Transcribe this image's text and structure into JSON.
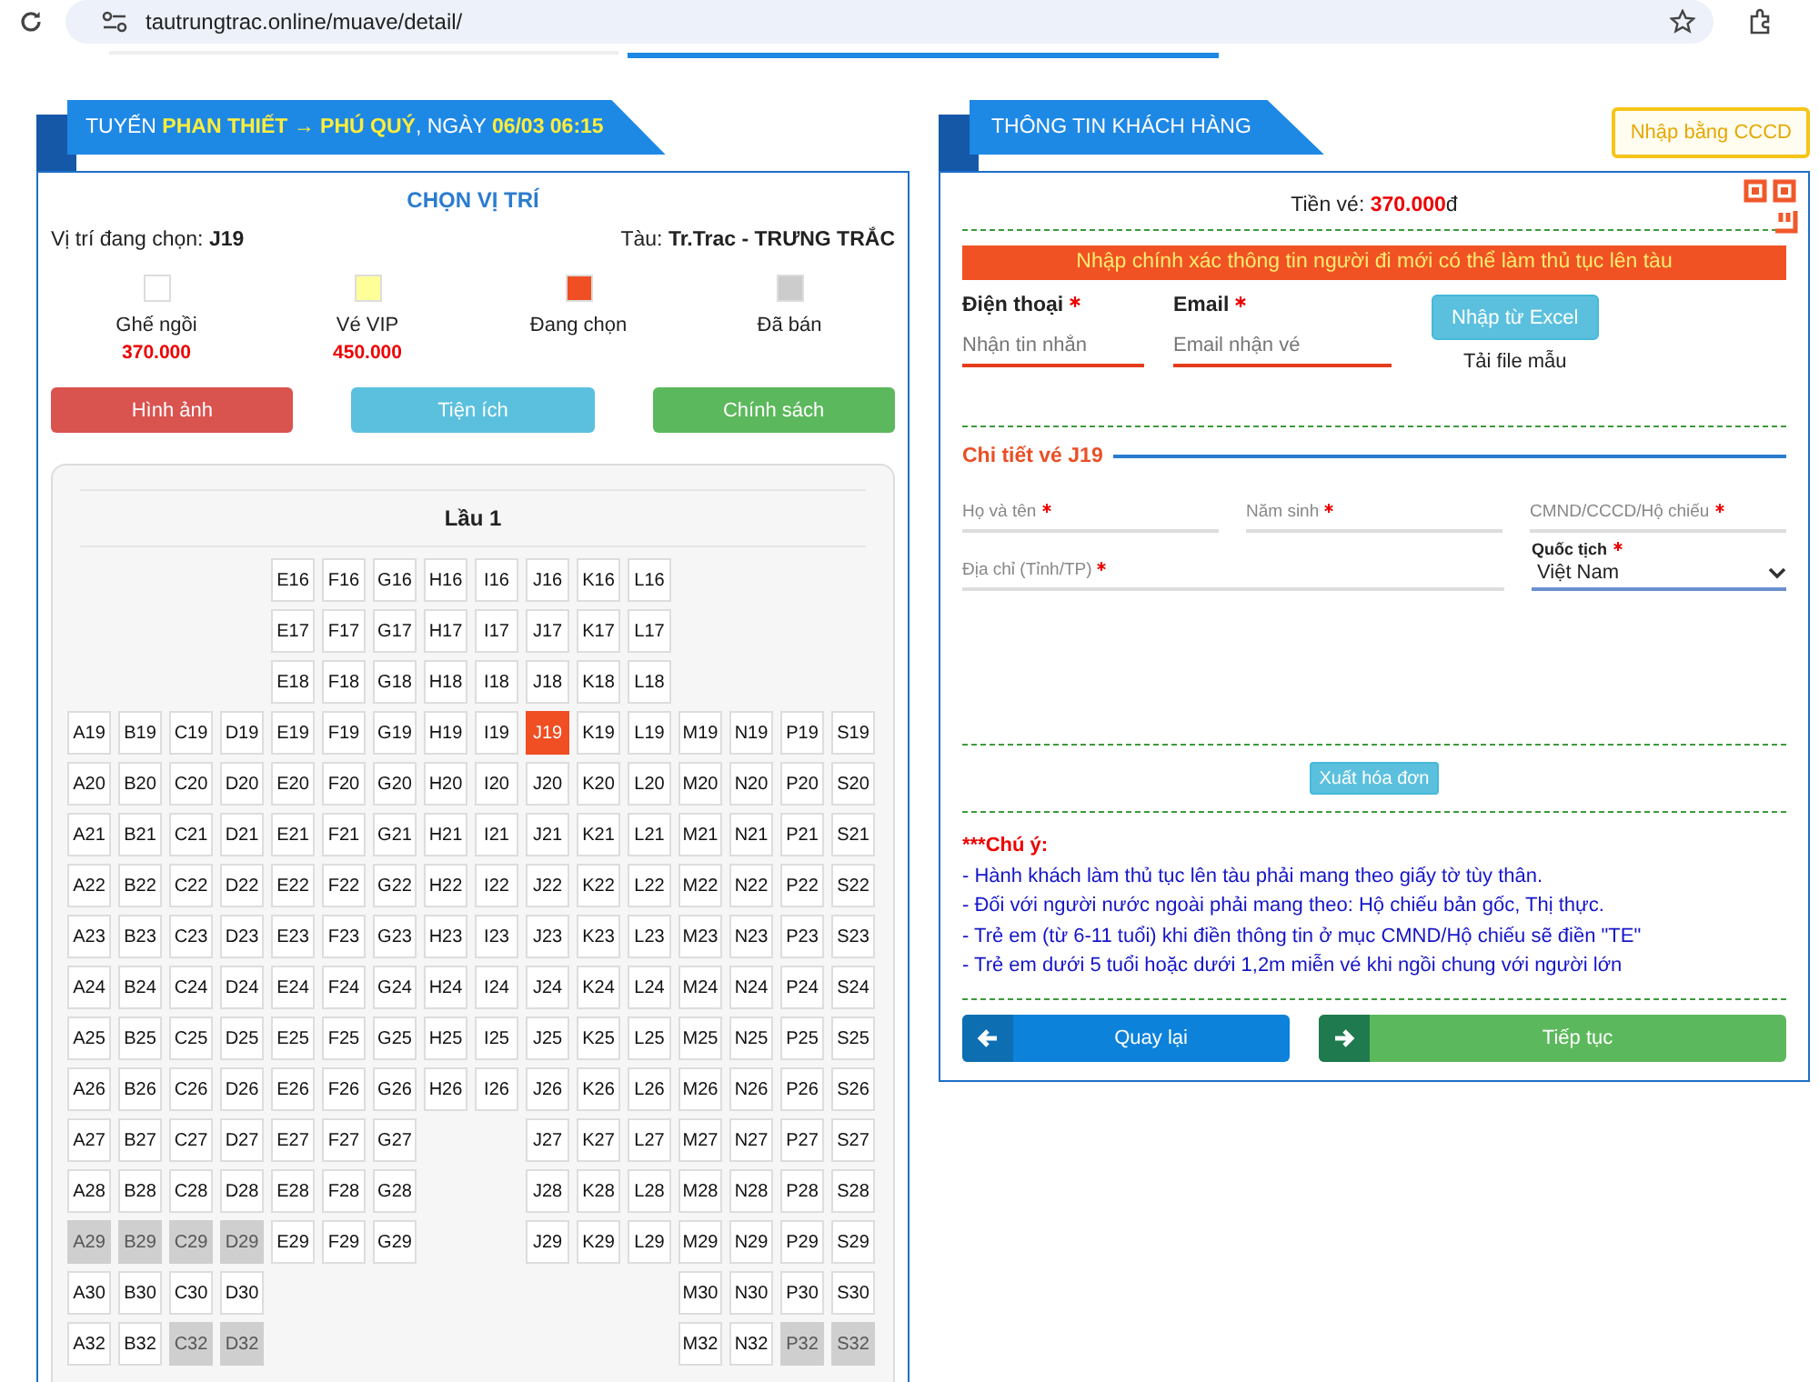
{
  "browser": {
    "url": "tautrungtrac.online/muave/detail/"
  },
  "trip": {
    "title": "TUYẾN **PHAN THIẾT → PHÚ QUÝ**, NGÀY **06/03 06:15**",
    "heading": "CHỌN VỊ TRÍ",
    "current_label": "Vị trí đang chọn:",
    "current_seat": "J19",
    "ship_label": "Tàu:",
    "ship_name": "Tr.Trac - TRƯNG TRẮC",
    "legend": [
      {
        "color": "#ffffff",
        "label": "Ghế ngồi",
        "price": "370.000"
      },
      {
        "color": "#ffff99",
        "label": "Vé VIP",
        "price": "450.000"
      },
      {
        "color": "#f04e23",
        "label": "Đang chọn"
      },
      {
        "color": "#cccccc",
        "label": "Đã bán"
      }
    ],
    "buttons": [
      {
        "label": "Hình ảnh",
        "color": "#d9534f"
      },
      {
        "label": "Tiện ích",
        "color": "#5bc0de"
      },
      {
        "label": "Chính sách",
        "color": "#5cb85c"
      }
    ],
    "deck": "Lầu 1",
    "rows": [
      {
        "seats": [
          {
            "kind": "gap"
          },
          {
            "kind": "gap"
          },
          {
            "kind": "gap"
          },
          {
            "kind": "gap"
          },
          {
            "kind": "seat",
            "label": "E16",
            "selected": false,
            "sold": false
          },
          {
            "kind": "seat",
            "label": "F16",
            "selected": false,
            "sold": false
          },
          {
            "kind": "seat",
            "label": "G16",
            "selected": false,
            "sold": false
          },
          {
            "kind": "seat",
            "label": "H16",
            "selected": false,
            "sold": false
          },
          {
            "kind": "seat",
            "label": "I16",
            "selected": false,
            "sold": false
          },
          {
            "kind": "seat",
            "label": "J16",
            "selected": false,
            "sold": false
          },
          {
            "kind": "seat",
            "label": "K16",
            "selected": false,
            "sold": false
          },
          {
            "kind": "seat",
            "label": "L16",
            "selected": false,
            "sold": false
          }
        ]
      },
      {
        "seats": [
          {
            "kind": "gap"
          },
          {
            "kind": "gap"
          },
          {
            "kind": "gap"
          },
          {
            "kind": "gap"
          },
          {
            "kind": "seat",
            "label": "E17",
            "selected": false,
            "sold": false
          },
          {
            "kind": "seat",
            "label": "F17",
            "selected": false,
            "sold": false
          },
          {
            "kind": "seat",
            "label": "G17",
            "selected": false,
            "sold": false
          },
          {
            "kind": "seat",
            "label": "H17",
            "selected": false,
            "sold": false
          },
          {
            "kind": "seat",
            "label": "I17",
            "selected": false,
            "sold": false
          },
          {
            "kind": "seat",
            "label": "J17",
            "selected": false,
            "sold": false
          },
          {
            "kind": "seat",
            "label": "K17",
            "selected": false,
            "sold": false
          },
          {
            "kind": "seat",
            "label": "L17",
            "selected": false,
            "sold": false
          }
        ]
      },
      {
        "seats": [
          {
            "kind": "gap"
          },
          {
            "kind": "gap"
          },
          {
            "kind": "gap"
          },
          {
            "kind": "gap"
          },
          {
            "kind": "seat",
            "label": "E18",
            "selected": false,
            "sold": false
          },
          {
            "kind": "seat",
            "label": "F18",
            "selected": false,
            "sold": false
          },
          {
            "kind": "seat",
            "label": "G18",
            "selected": false,
            "sold": false
          },
          {
            "kind": "seat",
            "label": "H18",
            "selected": false,
            "sold": false
          },
          {
            "kind": "seat",
            "label": "I18",
            "selected": false,
            "sold": false
          },
          {
            "kind": "seat",
            "label": "J18",
            "selected": false,
            "sold": false
          },
          {
            "kind": "seat",
            "label": "K18",
            "selected": false,
            "sold": false
          },
          {
            "kind": "seat",
            "label": "L18",
            "selected": false,
            "sold": false
          }
        ]
      },
      {
        "seats": [
          {
            "kind": "seat",
            "label": "A19",
            "selected": false,
            "sold": false
          },
          {
            "kind": "seat",
            "label": "B19",
            "selected": false,
            "sold": false
          },
          {
            "kind": "seat",
            "label": "C19",
            "selected": false,
            "sold": false
          },
          {
            "kind": "seat",
            "label": "D19",
            "selected": false,
            "sold": false
          },
          {
            "kind": "seat",
            "label": "E19",
            "selected": false,
            "sold": false
          },
          {
            "kind": "seat",
            "label": "F19",
            "selected": false,
            "sold": false
          },
          {
            "kind": "seat",
            "label": "G19",
            "selected": false,
            "sold": false
          },
          {
            "kind": "seat",
            "label": "H19",
            "selected": false,
            "sold": false
          },
          {
            "kind": "seat",
            "label": "I19",
            "selected": false,
            "sold": false
          },
          {
            "kind": "seat",
            "label": "J19",
            "selected": true,
            "sold": false
          },
          {
            "kind": "seat",
            "label": "K19",
            "selected": false,
            "sold": false
          },
          {
            "kind": "seat",
            "label": "L19",
            "selected": false,
            "sold": false
          },
          {
            "kind": "seat",
            "label": "M19",
            "selected": false,
            "sold": false
          },
          {
            "kind": "seat",
            "label": "N19",
            "selected": false,
            "sold": false
          },
          {
            "kind": "seat",
            "label": "P19",
            "selected": false,
            "sold": false
          },
          {
            "kind": "seat",
            "label": "S19",
            "selected": false,
            "sold": false
          }
        ]
      },
      {
        "seats": [
          {
            "kind": "seat",
            "label": "A20",
            "selected": false,
            "sold": false
          },
          {
            "kind": "seat",
            "label": "B20",
            "selected": false,
            "sold": false
          },
          {
            "kind": "seat",
            "label": "C20",
            "selected": false,
            "sold": false
          },
          {
            "kind": "seat",
            "label": "D20",
            "selected": false,
            "sold": false
          },
          {
            "kind": "seat",
            "label": "E20",
            "selected": false,
            "sold": false
          },
          {
            "kind": "seat",
            "label": "F20",
            "selected": false,
            "sold": false
          },
          {
            "kind": "seat",
            "label": "G20",
            "selected": false,
            "sold": false
          },
          {
            "kind": "seat",
            "label": "H20",
            "selected": false,
            "sold": false
          },
          {
            "kind": "seat",
            "label": "I20",
            "selected": false,
            "sold": false
          },
          {
            "kind": "seat",
            "label": "J20",
            "selected": false,
            "sold": false
          },
          {
            "kind": "seat",
            "label": "K20",
            "selected": false,
            "sold": false
          },
          {
            "kind": "seat",
            "label": "L20",
            "selected": false,
            "sold": false
          },
          {
            "kind": "seat",
            "label": "M20",
            "selected": false,
            "sold": false
          },
          {
            "kind": "seat",
            "label": "N20",
            "selected": false,
            "sold": false
          },
          {
            "kind": "seat",
            "label": "P20",
            "selected": false,
            "sold": false
          },
          {
            "kind": "seat",
            "label": "S20",
            "selected": false,
            "sold": false
          }
        ]
      },
      {
        "seats": [
          {
            "kind": "seat",
            "label": "A21",
            "selected": false,
            "sold": false
          },
          {
            "kind": "seat",
            "label": "B21",
            "selected": false,
            "sold": false
          },
          {
            "kind": "seat",
            "label": "C21",
            "selected": false,
            "sold": false
          },
          {
            "kind": "seat",
            "label": "D21",
            "selected": false,
            "sold": false
          },
          {
            "kind": "seat",
            "label": "E21",
            "selected": false,
            "sold": false
          },
          {
            "kind": "seat",
            "label": "F21",
            "selected": false,
            "sold": false
          },
          {
            "kind": "seat",
            "label": "G21",
            "selected": false,
            "sold": false
          },
          {
            "kind": "seat",
            "label": "H21",
            "selected": false,
            "sold": false
          },
          {
            "kind": "seat",
            "label": "I21",
            "selected": false,
            "sold": false
          },
          {
            "kind": "seat",
            "label": "J21",
            "selected": false,
            "sold": false
          },
          {
            "kind": "seat",
            "label": "K21",
            "selected": false,
            "sold": false
          },
          {
            "kind": "seat",
            "label": "L21",
            "selected": false,
            "sold": false
          },
          {
            "kind": "seat",
            "label": "M21",
            "selected": false,
            "sold": false
          },
          {
            "kind": "seat",
            "label": "N21",
            "selected": false,
            "sold": false
          },
          {
            "kind": "seat",
            "label": "P21",
            "selected": false,
            "sold": false
          },
          {
            "kind": "seat",
            "label": "S21",
            "selected": false,
            "sold": false
          }
        ]
      },
      {
        "seats": [
          {
            "kind": "seat",
            "label": "A22",
            "selected": false,
            "sold": false
          },
          {
            "kind": "seat",
            "label": "B22",
            "selected": false,
            "sold": false
          },
          {
            "kind": "seat",
            "label": "C22",
            "selected": false,
            "sold": false
          },
          {
            "kind": "seat",
            "label": "D22",
            "selected": false,
            "sold": false
          },
          {
            "kind": "seat",
            "label": "E22",
            "selected": false,
            "sold": false
          },
          {
            "kind": "seat",
            "label": "F22",
            "selected": false,
            "sold": false
          },
          {
            "kind": "seat",
            "label": "G22",
            "selected": false,
            "sold": false
          },
          {
            "kind": "seat",
            "label": "H22",
            "selected": false,
            "sold": false
          },
          {
            "kind": "seat",
            "label": "I22",
            "selected": false,
            "sold": false
          },
          {
            "kind": "seat",
            "label": "J22",
            "selected": false,
            "sold": false
          },
          {
            "kind": "seat",
            "label": "K22",
            "selected": false,
            "sold": false
          },
          {
            "kind": "seat",
            "label": "L22",
            "selected": false,
            "sold": false
          },
          {
            "kind": "seat",
            "label": "M22",
            "selected": false,
            "sold": false
          },
          {
            "kind": "seat",
            "label": "N22",
            "selected": false,
            "sold": false
          },
          {
            "kind": "seat",
            "label": "P22",
            "selected": false,
            "sold": false
          },
          {
            "kind": "seat",
            "label": "S22",
            "selected": false,
            "sold": false
          }
        ]
      },
      {
        "seats": [
          {
            "kind": "seat",
            "label": "A23",
            "selected": false,
            "sold": false
          },
          {
            "kind": "seat",
            "label": "B23",
            "selected": false,
            "sold": false
          },
          {
            "kind": "seat",
            "label": "C23",
            "selected": false,
            "sold": false
          },
          {
            "kind": "seat",
            "label": "D23",
            "selected": false,
            "sold": false
          },
          {
            "kind": "seat",
            "label": "E23",
            "selected": false,
            "sold": false
          },
          {
            "kind": "seat",
            "label": "F23",
            "selected": false,
            "sold": false
          },
          {
            "kind": "seat",
            "label": "G23",
            "selected": false,
            "sold": false
          },
          {
            "kind": "seat",
            "label": "H23",
            "selected": false,
            "sold": false
          },
          {
            "kind": "seat",
            "label": "I23",
            "selected": false,
            "sold": false
          },
          {
            "kind": "seat",
            "label": "J23",
            "selected": false,
            "sold": false
          },
          {
            "kind": "seat",
            "label": "K23",
            "selected": false,
            "sold": false
          },
          {
            "kind": "seat",
            "label": "L23",
            "selected": false,
            "sold": false
          },
          {
            "kind": "seat",
            "label": "M23",
            "selected": false,
            "sold": false
          },
          {
            "kind": "seat",
            "label": "N23",
            "selected": false,
            "sold": false
          },
          {
            "kind": "seat",
            "label": "P23",
            "selected": false,
            "sold": false
          },
          {
            "kind": "seat",
            "label": "S23",
            "selected": false,
            "sold": false
          }
        ]
      },
      {
        "seats": [
          {
            "kind": "seat",
            "label": "A24",
            "selected": false,
            "sold": false
          },
          {
            "kind": "seat",
            "label": "B24",
            "selected": false,
            "sold": false
          },
          {
            "kind": "seat",
            "label": "C24",
            "selected": false,
            "sold": false
          },
          {
            "kind": "seat",
            "label": "D24",
            "selected": false,
            "sold": false
          },
          {
            "kind": "seat",
            "label": "E24",
            "selected": false,
            "sold": false
          },
          {
            "kind": "seat",
            "label": "F24",
            "selected": false,
            "sold": false
          },
          {
            "kind": "seat",
            "label": "G24",
            "selected": false,
            "sold": false
          },
          {
            "kind": "seat",
            "label": "H24",
            "selected": false,
            "sold": false
          },
          {
            "kind": "seat",
            "label": "I24",
            "selected": false,
            "sold": false
          },
          {
            "kind": "seat",
            "label": "J24",
            "selected": false,
            "sold": false
          },
          {
            "kind": "seat",
            "label": "K24",
            "selected": false,
            "sold": false
          },
          {
            "kind": "seat",
            "label": "L24",
            "selected": false,
            "sold": false
          },
          {
            "kind": "seat",
            "label": "M24",
            "selected": false,
            "sold": false
          },
          {
            "kind": "seat",
            "label": "N24",
            "selected": false,
            "sold": false
          },
          {
            "kind": "seat",
            "label": "P24",
            "selected": false,
            "sold": false
          },
          {
            "kind": "seat",
            "label": "S24",
            "selected": false,
            "sold": false
          }
        ]
      },
      {
        "seats": [
          {
            "kind": "seat",
            "label": "A25",
            "selected": false,
            "sold": false
          },
          {
            "kind": "seat",
            "label": "B25",
            "selected": false,
            "sold": false
          },
          {
            "kind": "seat",
            "label": "C25",
            "selected": false,
            "sold": false
          },
          {
            "kind": "seat",
            "label": "D25",
            "selected": false,
            "sold": false
          },
          {
            "kind": "seat",
            "label": "E25",
            "selected": false,
            "sold": false
          },
          {
            "kind": "seat",
            "label": "F25",
            "selected": false,
            "sold": false
          },
          {
            "kind": "seat",
            "label": "G25",
            "selected": false,
            "sold": false
          },
          {
            "kind": "seat",
            "label": "H25",
            "selected": false,
            "sold": false
          },
          {
            "kind": "seat",
            "label": "I25",
            "selected": false,
            "sold": false
          },
          {
            "kind": "seat",
            "label": "J25",
            "selected": false,
            "sold": false
          },
          {
            "kind": "seat",
            "label": "K25",
            "selected": false,
            "sold": false
          },
          {
            "kind": "seat",
            "label": "L25",
            "selected": false,
            "sold": false
          },
          {
            "kind": "seat",
            "label": "M25",
            "selected": false,
            "sold": false
          },
          {
            "kind": "seat",
            "label": "N25",
            "selected": false,
            "sold": false
          },
          {
            "kind": "seat",
            "label": "P25",
            "selected": false,
            "sold": false
          },
          {
            "kind": "seat",
            "label": "S25",
            "selected": false,
            "sold": false
          }
        ]
      },
      {
        "seats": [
          {
            "kind": "seat",
            "label": "A26",
            "selected": false,
            "sold": false
          },
          {
            "kind": "seat",
            "label": "B26",
            "selected": false,
            "sold": false
          },
          {
            "kind": "seat",
            "label": "C26",
            "selected": false,
            "sold": false
          },
          {
            "kind": "seat",
            "label": "D26",
            "selected": false,
            "sold": false
          },
          {
            "kind": "seat",
            "label": "E26",
            "selected": false,
            "sold": false
          },
          {
            "kind": "seat",
            "label": "F26",
            "selected": false,
            "sold": false
          },
          {
            "kind": "seat",
            "label": "G26",
            "selected": false,
            "sold": false
          },
          {
            "kind": "seat",
            "label": "H26",
            "selected": false,
            "sold": false
          },
          {
            "kind": "seat",
            "label": "I26",
            "selected": false,
            "sold": false
          },
          {
            "kind": "seat",
            "label": "J26",
            "selected": false,
            "sold": false
          },
          {
            "kind": "seat",
            "label": "K26",
            "selected": false,
            "sold": false
          },
          {
            "kind": "seat",
            "label": "L26",
            "selected": false,
            "sold": false
          },
          {
            "kind": "seat",
            "label": "M26",
            "selected": false,
            "sold": false
          },
          {
            "kind": "seat",
            "label": "N26",
            "selected": false,
            "sold": false
          },
          {
            "kind": "seat",
            "label": "P26",
            "selected": false,
            "sold": false
          },
          {
            "kind": "seat",
            "label": "S26",
            "selected": false,
            "sold": false
          }
        ]
      },
      {
        "seats": [
          {
            "kind": "seat",
            "label": "A27",
            "selected": false,
            "sold": false
          },
          {
            "kind": "seat",
            "label": "B27",
            "selected": false,
            "sold": false
          },
          {
            "kind": "seat",
            "label": "C27",
            "selected": false,
            "sold": false
          },
          {
            "kind": "seat",
            "label": "D27",
            "selected": false,
            "sold": false
          },
          {
            "kind": "seat",
            "label": "E27",
            "selected": false,
            "sold": false
          },
          {
            "kind": "seat",
            "label": "F27",
            "selected": false,
            "sold": false
          },
          {
            "kind": "seat",
            "label": "G27",
            "selected": false,
            "sold": false
          },
          {
            "kind": "gap"
          },
          {
            "kind": "gap"
          },
          {
            "kind": "seat",
            "label": "J27",
            "selected": false,
            "sold": false
          },
          {
            "kind": "seat",
            "label": "K27",
            "selected": false,
            "sold": false
          },
          {
            "kind": "seat",
            "label": "L27",
            "selected": false,
            "sold": false
          },
          {
            "kind": "seat",
            "label": "M27",
            "selected": false,
            "sold": false
          },
          {
            "kind": "seat",
            "label": "N27",
            "selected": false,
            "sold": false
          },
          {
            "kind": "seat",
            "label": "P27",
            "selected": false,
            "sold": false
          },
          {
            "kind": "seat",
            "label": "S27",
            "selected": false,
            "sold": false
          }
        ]
      },
      {
        "seats": [
          {
            "kind": "seat",
            "label": "A28",
            "selected": false,
            "sold": false
          },
          {
            "kind": "seat",
            "label": "B28",
            "selected": false,
            "sold": false
          },
          {
            "kind": "seat",
            "label": "C28",
            "selected": false,
            "sold": false
          },
          {
            "kind": "seat",
            "label": "D28",
            "selected": false,
            "sold": false
          },
          {
            "kind": "seat",
            "label": "E28",
            "selected": false,
            "sold": false
          },
          {
            "kind": "seat",
            "label": "F28",
            "selected": false,
            "sold": false
          },
          {
            "kind": "seat",
            "label": "G28",
            "selected": false,
            "sold": false
          },
          {
            "kind": "gap"
          },
          {
            "kind": "gap"
          },
          {
            "kind": "seat",
            "label": "J28",
            "selected": false,
            "sold": false
          },
          {
            "kind": "seat",
            "label": "K28",
            "selected": false,
            "sold": false
          },
          {
            "kind": "seat",
            "label": "L28",
            "selected": false,
            "sold": false
          },
          {
            "kind": "seat",
            "label": "M28",
            "selected": false,
            "sold": false
          },
          {
            "kind": "seat",
            "label": "N28",
            "selected": false,
            "sold": false
          },
          {
            "kind": "seat",
            "label": "P28",
            "selected": false,
            "sold": false
          },
          {
            "kind": "seat",
            "label": "S28",
            "selected": false,
            "sold": false
          }
        ]
      },
      {
        "seats": [
          {
            "kind": "seat",
            "label": "A29",
            "selected": false,
            "sold": true
          },
          {
            "kind": "seat",
            "label": "B29",
            "selected": false,
            "sold": true
          },
          {
            "kind": "seat",
            "label": "C29",
            "selected": false,
            "sold": true
          },
          {
            "kind": "seat",
            "label": "D29",
            "selected": false,
            "sold": true
          },
          {
            "kind": "seat",
            "label": "E29",
            "selected": false,
            "sold": false
          },
          {
            "kind": "seat",
            "label": "F29",
            "selected": false,
            "sold": false
          },
          {
            "kind": "seat",
            "label": "G29",
            "selected": false,
            "sold": false
          },
          {
            "kind": "gap"
          },
          {
            "kind": "gap"
          },
          {
            "kind": "seat",
            "label": "J29",
            "selected": false,
            "sold": false
          },
          {
            "kind": "seat",
            "label": "K29",
            "selected": false,
            "sold": false
          },
          {
            "kind": "seat",
            "label": "L29",
            "selected": false,
            "sold": false
          },
          {
            "kind": "seat",
            "label": "M29",
            "selected": false,
            "sold": false
          },
          {
            "kind": "seat",
            "label": "N29",
            "selected": false,
            "sold": false
          },
          {
            "kind": "seat",
            "label": "P29",
            "selected": false,
            "sold": false
          },
          {
            "kind": "seat",
            "label": "S29",
            "selected": false,
            "sold": false
          }
        ]
      },
      {
        "seats": [
          {
            "kind": "seat",
            "label": "A30",
            "selected": false,
            "sold": false
          },
          {
            "kind": "seat",
            "label": "B30",
            "selected": false,
            "sold": false
          },
          {
            "kind": "seat",
            "label": "C30",
            "selected": false,
            "sold": false
          },
          {
            "kind": "seat",
            "label": "D30",
            "selected": false,
            "sold": false
          },
          {
            "kind": "gap"
          },
          {
            "kind": "gap"
          },
          {
            "kind": "gap"
          },
          {
            "kind": "gap"
          },
          {
            "kind": "gap"
          },
          {
            "kind": "gap"
          },
          {
            "kind": "gap"
          },
          {
            "kind": "gap"
          },
          {
            "kind": "seat",
            "label": "M30",
            "selected": false,
            "sold": false
          },
          {
            "kind": "seat",
            "label": "N30",
            "selected": false,
            "sold": false
          },
          {
            "kind": "seat",
            "label": "P30",
            "selected": false,
            "sold": false
          },
          {
            "kind": "seat",
            "label": "S30",
            "selected": false,
            "sold": false
          }
        ]
      },
      {
        "seats": [
          {
            "kind": "seat",
            "label": "A32",
            "selected": false,
            "sold": false
          },
          {
            "kind": "seat",
            "label": "B32",
            "selected": false,
            "sold": false
          },
          {
            "kind": "seat",
            "label": "C32",
            "selected": false,
            "sold": true
          },
          {
            "kind": "seat",
            "label": "D32",
            "selected": false,
            "sold": true
          },
          {
            "kind": "gap"
          },
          {
            "kind": "gap"
          },
          {
            "kind": "gap"
          },
          {
            "kind": "gap"
          },
          {
            "kind": "gap"
          },
          {
            "kind": "gap"
          },
          {
            "kind": "gap"
          },
          {
            "kind": "gap"
          },
          {
            "kind": "seat",
            "label": "M32",
            "selected": false,
            "sold": false
          },
          {
            "kind": "seat",
            "label": "N32",
            "selected": false,
            "sold": false
          },
          {
            "kind": "seat",
            "label": "P32",
            "selected": false,
            "sold": true
          },
          {
            "kind": "seat",
            "label": "S32",
            "selected": false,
            "sold": true
          }
        ]
      }
    ]
  },
  "customer": {
    "title": "THÔNG TIN KHÁCH HÀNG",
    "cccd_button": "Nhập bằng CCCD",
    "price_label": "Tiền vé:",
    "price_value": "370.000",
    "price_unit": "đ",
    "notice": "Nhập chính xác thông tin người đi mới có thể làm thủ tục lên tàu",
    "contact_fields": [
      {
        "label": "Điện thoại",
        "required": true,
        "placeholder": "Nhận tin nhắn"
      },
      {
        "label": "Email",
        "required": true,
        "placeholder": "Email nhận vé"
      }
    ],
    "excel_button": "Nhập từ Excel",
    "template_link": "Tải file mẫu",
    "detail_title": "Chi tiết vé J19",
    "detail_rows": [
      [
        {
          "kind": "text",
          "label": "Họ và tên",
          "required": true
        },
        {
          "kind": "text",
          "label": "Năm sinh",
          "required": true
        },
        {
          "kind": "text",
          "label": "CMND/CCCD/Hộ chiếu",
          "required": true
        }
      ],
      [
        {
          "kind": "text",
          "label": "Địa chỉ (Tỉnh/TP)",
          "required": true
        },
        {
          "kind": "select",
          "label": "Quốc tịch",
          "required": true,
          "value": "Việt Nam"
        }
      ]
    ],
    "invoice_button": "Xuất hóa đơn",
    "notes_title": "***Chú ý:",
    "notes": [
      "- Hành khách làm thủ tục lên tàu phải mang theo giấy tờ tùy thân.",
      "- Đối với người nước ngoài phải mang theo: Hộ chiếu bản gốc, Thị thực.",
      "- Trẻ em (từ 6-11 tuổi) khi điền thông tin ở mục CMND/Hộ chiếu sẽ điền \"TE\"",
      "- Trẻ em dưới 5 tuổi hoặc dưới 1,2m miễn vé khi ngồi chung với người lớn"
    ],
    "nav": [
      {
        "kind": "back",
        "label": "Quay lại"
      },
      {
        "kind": "next",
        "label": "Tiếp tục"
      }
    ]
  }
}
